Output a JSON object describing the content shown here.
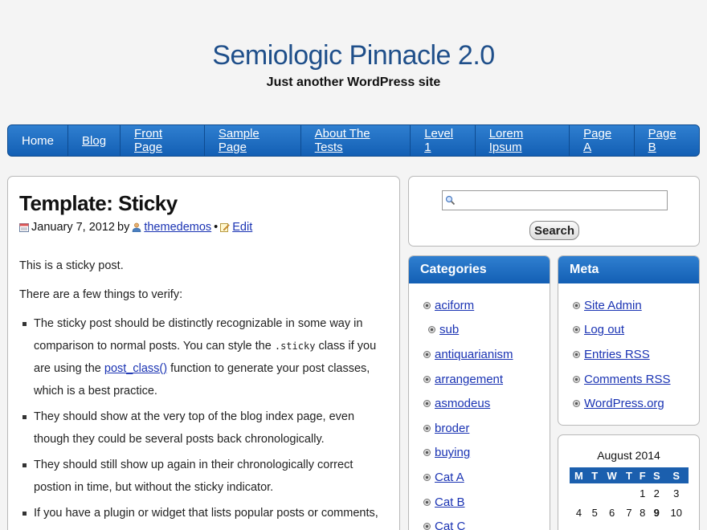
{
  "site": {
    "title": "Semiologic Pinnacle 2.0",
    "tagline": "Just another WordPress site"
  },
  "nav": {
    "items": [
      "Home",
      "Blog",
      "Front Page",
      "Sample Page",
      "About The Tests",
      "Level 1",
      "Lorem Ipsum",
      "Page A",
      "Page B"
    ]
  },
  "post": {
    "title": "Template: Sticky",
    "date": "January 7, 2012",
    "by": "by",
    "author": "themedemos",
    "sep": "•",
    "edit": "Edit",
    "p1": "This is a sticky post.",
    "p2": "There are a few things to verify:",
    "li1_a": "The sticky post should be distinctly recognizable in some way in comparison to normal posts. You can style the ",
    "li1_code": ".sticky",
    "li1_b": " class if you are using the ",
    "li1_link": "post_class()",
    "li1_c": " function to generate your post classes, which is a best practice.",
    "li2": "They should show at the very top of the blog index page, even though they could be several posts back chronologically.",
    "li3": "They should still show up again in their chronologically correct postion in time, but without the sticky indicator.",
    "li4": "If you have a plugin or widget that lists popular posts or comments,"
  },
  "search": {
    "button": "Search",
    "placeholder": ""
  },
  "categories": {
    "title": "Categories",
    "items": [
      "aciform",
      "sub",
      "antiquarianism",
      "arrangement",
      "asmodeus",
      "broder",
      "buying",
      "Cat A",
      "Cat B",
      "Cat C"
    ]
  },
  "meta": {
    "title": "Meta",
    "items": [
      "Site Admin",
      "Log out",
      "Entries RSS",
      "Comments RSS",
      "WordPress.org"
    ]
  },
  "calendar": {
    "caption": "August 2014",
    "days": [
      "M",
      "T",
      "W",
      "T",
      "F",
      "S",
      "S"
    ],
    "row1": [
      "",
      "",
      "",
      "",
      "1",
      "2",
      "3"
    ],
    "row2": [
      "4",
      "5",
      "6",
      "7",
      "8",
      "9",
      "10"
    ]
  },
  "colors": {
    "nav_top": "#2f7fd0",
    "nav_bottom": "#135fb4",
    "link": "#1a33b3",
    "title": "#1f4f8a"
  }
}
